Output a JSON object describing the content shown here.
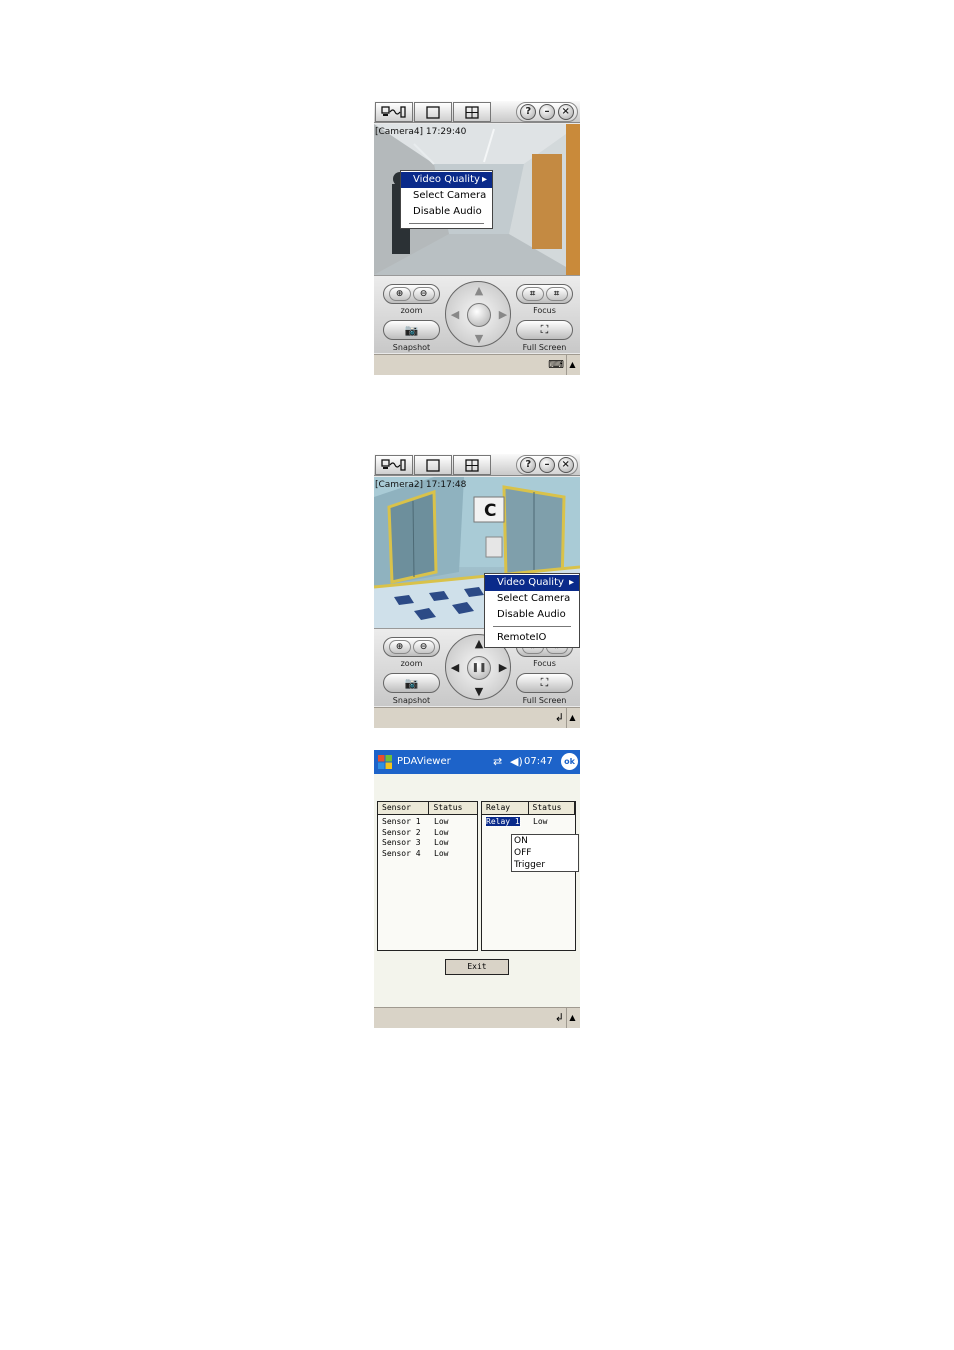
{
  "screen1": {
    "osd": "[Camera4] 17:29:40",
    "menu": [
      "Video Quality",
      "Select Camera",
      "Disable Audio"
    ],
    "panel": {
      "zoom": "zoom",
      "focus": "Focus",
      "snapshot": "Snapshot",
      "fullscreen": "Full Screen"
    }
  },
  "screen2": {
    "osd": "[Camera2] 17:17:48",
    "sign": "C",
    "menu": [
      "Video Quality",
      "Select Camera",
      "Disable Audio",
      "RemoteIO"
    ],
    "panel": {
      "zoom": "zoom",
      "focus": "Focus",
      "snapshot": "Snapshot",
      "fullscreen": "Full Screen"
    }
  },
  "toolbar": {
    "help": "?",
    "minimize": "–",
    "close": "×"
  },
  "screen3": {
    "app_title": "PDAViewer",
    "clock": "07:47",
    "ok": "ok",
    "sensor_table": {
      "headers": [
        "Sensor",
        "Status"
      ],
      "rows": [
        [
          "Sensor 1",
          "Low"
        ],
        [
          "Sensor 2",
          "Low"
        ],
        [
          "Sensor 3",
          "Low"
        ],
        [
          "Sensor 4",
          "Low"
        ]
      ]
    },
    "relay_table": {
      "headers": [
        "Relay",
        "Status"
      ],
      "rows": [
        [
          "Relay 1",
          "Low"
        ]
      ]
    },
    "popup": [
      "ON",
      "OFF",
      "Trigger"
    ],
    "exit": "Exit"
  }
}
